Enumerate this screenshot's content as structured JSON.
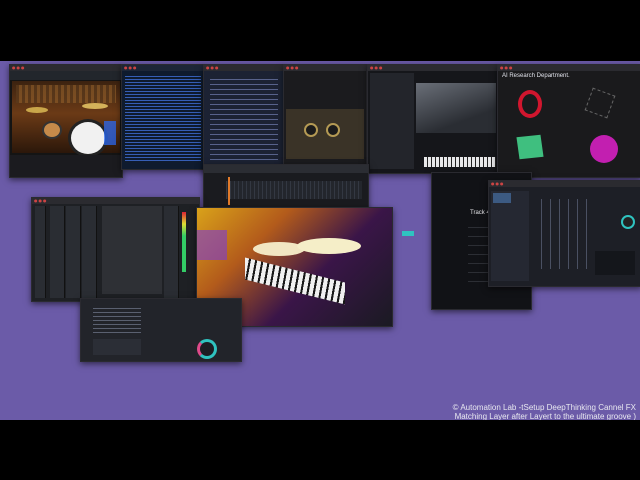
{
  "caption": {
    "line1": "© Automation Lab -tSetup DeepThinking Cannel FX",
    "line2": "Matching Layer after Layert to the ultimate groove )"
  },
  "windows": {
    "research": {
      "title": "AI Research Department."
    },
    "track": {
      "title": "Track 4"
    }
  },
  "colors": {
    "desktop": "#6b5ba8",
    "accent_cyan": "#2fc3c0",
    "ring_red": "#d1162e",
    "shape_green": "#3fbf7f",
    "shape_magenta": "#c21fb0"
  }
}
